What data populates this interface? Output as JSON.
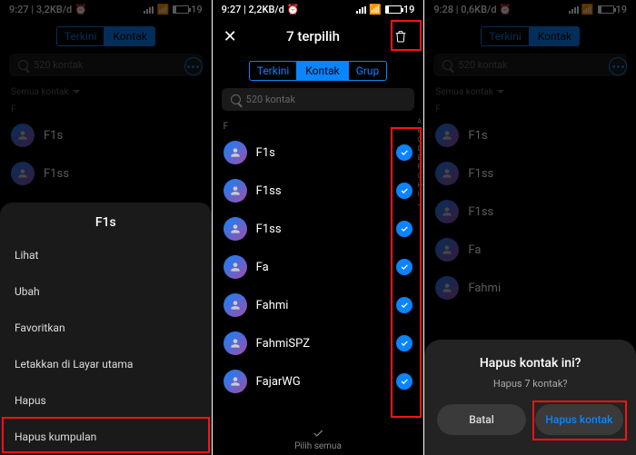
{
  "status": {
    "time1": "9:27",
    "time2": "9:27",
    "time3": "9:28",
    "net1": "3,2KB/d",
    "net2": "2,2KB/d",
    "net3": "0,6KB/d",
    "batt": "19",
    "alarm": "⏰"
  },
  "tabs": {
    "recent": "Terkini",
    "contacts": "Kontak",
    "groups": "Grup"
  },
  "search": {
    "placeholder": "520 kontak"
  },
  "section": {
    "all": "Semua kontak",
    "letter_f": "F"
  },
  "s1": {
    "contacts": [
      "F1s",
      "F1ss"
    ],
    "sheet_title": "F1s",
    "options": [
      "Lihat",
      "Ubah",
      "Favoritkan",
      "Letakkan di Layar utama",
      "Hapus",
      "Hapus kumpulan"
    ]
  },
  "s2": {
    "title": "7 terpilih",
    "contacts": [
      "F1s",
      "F1ss",
      "F1ss",
      "Fa",
      "Fahmi",
      "FahmiSPZ",
      "FajarWG"
    ],
    "footer": "Pilih semua"
  },
  "s3": {
    "contacts": [
      "F1s",
      "F1ss",
      "F1ss",
      "Fa",
      "Fahmi"
    ],
    "dialog_title": "Hapus kontak ini?",
    "dialog_body": "Hapus 7 kontak?",
    "cancel": "Batal",
    "confirm": "Hapus kontak"
  },
  "index": [
    "A",
    "B",
    "C",
    "D",
    "E",
    "F",
    "G",
    "H",
    "I",
    "J"
  ]
}
